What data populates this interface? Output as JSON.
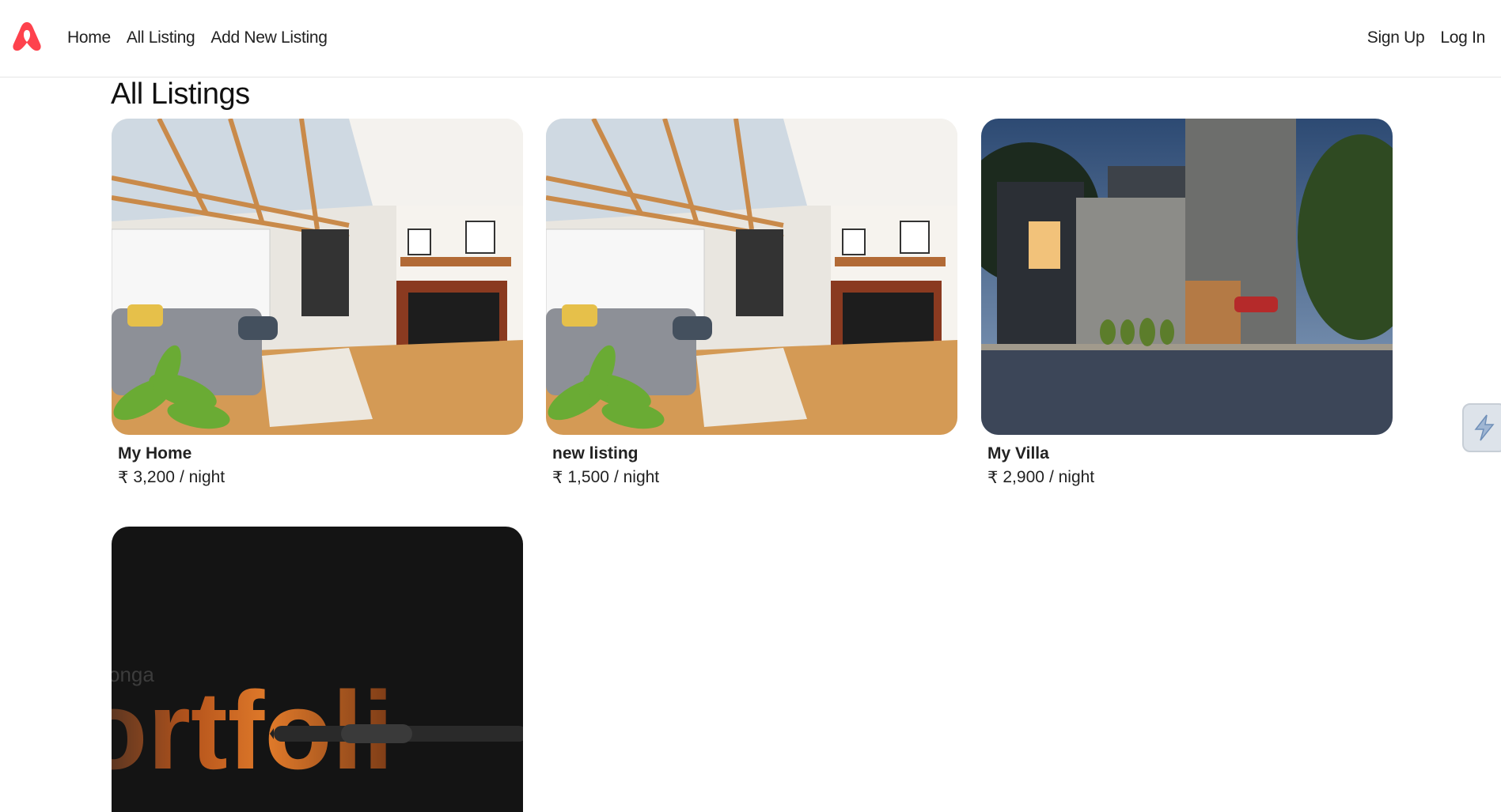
{
  "navbar": {
    "logo_icon": "airbnb-logo-icon",
    "brand_color": "#fe424d",
    "left_links": [
      "Home",
      "All Listing",
      "Add New Listing"
    ],
    "right_links": [
      "Sign Up",
      "Log In"
    ]
  },
  "page": {
    "title": "All Listings"
  },
  "listings": [
    {
      "title": "My Home",
      "currency": "₹",
      "price": "3,200",
      "unit": "/ night",
      "image": "living-room-photo"
    },
    {
      "title": "new listing",
      "currency": "₹",
      "price": "1,500",
      "unit": "/ night",
      "image": "living-room-photo"
    },
    {
      "title": "My Villa",
      "currency": "₹",
      "price": "2,900",
      "unit": "/ night",
      "image": "modern-villa-night-photo"
    },
    {
      "image": "portfolio-graphic",
      "image_text_small": "onga",
      "image_text_large": "ortfoli"
    }
  ],
  "side_widget": {
    "icon": "lightning-icon"
  }
}
